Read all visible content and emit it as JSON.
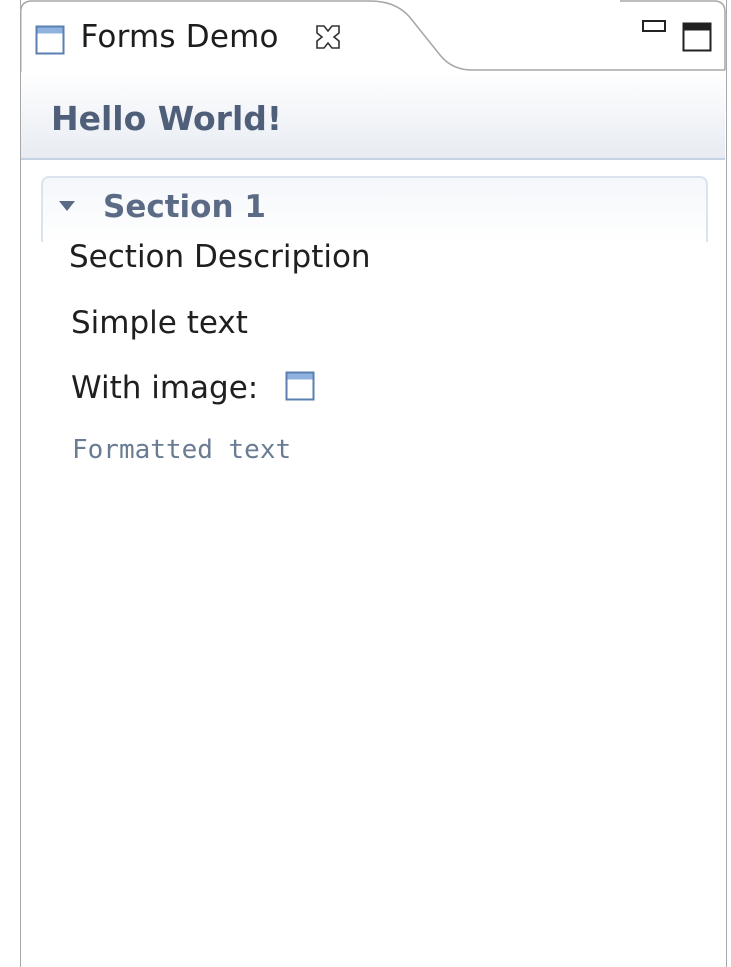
{
  "tab": {
    "title": "Forms Demo",
    "icon": "view-window-icon",
    "close_icon": "close-icon"
  },
  "view_controls": {
    "minimize_icon": "minimize-icon",
    "maximize_icon": "maximize-icon"
  },
  "form": {
    "title": "Hello World!"
  },
  "section": {
    "title": "Section 1",
    "expanded": true,
    "toggle_icon": "triangle-down-icon",
    "description": "Section Description",
    "items": {
      "simple_text": "Simple text",
      "with_image_label": "With image:",
      "with_image_icon": "view-window-icon",
      "formatted_text": "Formatted text"
    }
  },
  "colors": {
    "form_title": "#4f5f7a",
    "section_title": "#5b6b85",
    "formatted_text": "#6a7c93",
    "icon_frame": "#5a7fb0",
    "icon_header": "#8fb3de"
  }
}
